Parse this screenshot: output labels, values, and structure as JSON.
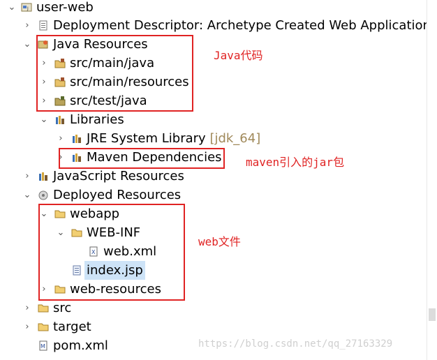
{
  "tree": {
    "project": "user-web",
    "deployment_descriptor": "Deployment Descriptor: Archetype Created Web Application",
    "java_resources": "Java Resources",
    "src_main_java": "src/main/java",
    "src_main_resources": "src/main/resources",
    "src_test_java": "src/test/java",
    "libraries": "Libraries",
    "jre_library": "JRE System Library",
    "jre_version": "[jdk_64]",
    "maven_dependencies": "Maven Dependencies",
    "javascript_resources": "JavaScript Resources",
    "deployed_resources": "Deployed Resources",
    "webapp": "webapp",
    "web_inf": "WEB-INF",
    "web_xml": "web.xml",
    "index_jsp": "index.jsp",
    "web_resources": "web-resources",
    "src": "src",
    "target": "target",
    "pom_xml": "pom.xml"
  },
  "annotations": {
    "java_code": "Java代码",
    "maven_jars": "maven引入的jar包",
    "web_files": "web文件"
  },
  "watermark": "https://blog.csdn.net/qq_27163329",
  "colors": {
    "annotation_red": "#e02323",
    "selection": "#cde3f7",
    "decoration": "#a0895a"
  },
  "icons": {
    "project": "web-project-icon",
    "folder": "folder-icon",
    "package_folder": "source-folder-icon",
    "library": "library-icon",
    "xml_file": "xml-file-icon",
    "jsp_file": "jsp-file-icon",
    "maven_file": "maven-pom-icon"
  }
}
